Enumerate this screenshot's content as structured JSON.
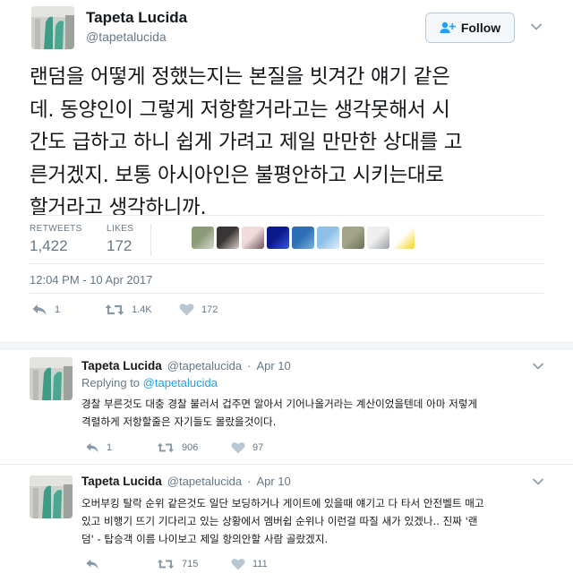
{
  "colors": {
    "accent": "#1da1f2",
    "muted": "#657786",
    "text": "#14171a",
    "like_heart": "#b8c7d2"
  },
  "main_tweet": {
    "author_name": "Tapeta Lucida",
    "author_handle": "@tapetalucida",
    "follow_label": "Follow",
    "follow_icon": "add-person-icon",
    "text_lines": [
      "랜덤을 어떻게 정했는지는 본질을 빗겨간 얘기 같은",
      "데. 동양인이 그렇게 저항할거라고는 생각못해서 시",
      "간도 급하고 하니 쉽게 가려고 제일 만만한 상대를 고",
      "른거겠지. 보통 아시아인은 불평안하고 시키는대로",
      "할거라고 생각하니까."
    ],
    "retweets_label": "RETWEETS",
    "retweets_count": "1,422",
    "likes_label": "LIKES",
    "likes_count": "172",
    "timestamp": "12:04 PM - 10 Apr 2017",
    "reply_count": "1",
    "retweet_action_count": "1.4K",
    "like_action_count": "172",
    "likers": [
      {
        "colors": [
          "#8b9a78",
          "#d6d9cf"
        ]
      },
      {
        "colors": [
          "#3a3434",
          "#d9d1c7"
        ]
      },
      {
        "colors": [
          "#f0dada",
          "#6c5560"
        ]
      },
      {
        "colors": [
          "#0a1a8a",
          "#3a58d6"
        ]
      },
      {
        "colors": [
          "#2c6fb4",
          "#7bb0dc"
        ]
      },
      {
        "colors": [
          "#8ec0e8",
          "#dff0fb"
        ]
      },
      {
        "colors": [
          "#a3a48a",
          "#6d7257"
        ]
      },
      {
        "colors": [
          "#efefee",
          "#9aa0a6"
        ]
      },
      {
        "colors": [
          "#ffffff",
          "#f2d51e"
        ]
      }
    ]
  },
  "replies": [
    {
      "author_name": "Tapeta Lucida",
      "author_handle": "@tapetalucida",
      "date": "Apr 10",
      "replying_prefix": "Replying to",
      "replying_to": "@tapetalucida",
      "text_lines": [
        "경찰 부른것도 대충 경찰 불러서 겁주면 알아서 기어나올거라는 계산이었을텐데 아마 저렇게",
        "격렬하게 저항할줄은 자기들도 몰랐을것이다."
      ],
      "reply_count": "1",
      "retweet_count": "906",
      "like_count": "97"
    },
    {
      "author_name": "Tapeta Lucida",
      "author_handle": "@tapetalucida",
      "date": "Apr 10",
      "text_lines": [
        "오버부킹 탈락 순위 같은것도 일단 보딩하거나 게이트에 있을때 얘기고 다 타서 안전벨트 매고",
        "있고 비행기 뜨기 기다리고 있는 상황에서 멤버쉽 순위나 이런걸 따질 새가 있겠나.. 진짜 '랜",
        "덤' - 탑승객 이름 나이보고 제일 항의안할 사람 골랐겠지."
      ],
      "reply_count": "",
      "retweet_count": "715",
      "like_count": "111"
    }
  ]
}
